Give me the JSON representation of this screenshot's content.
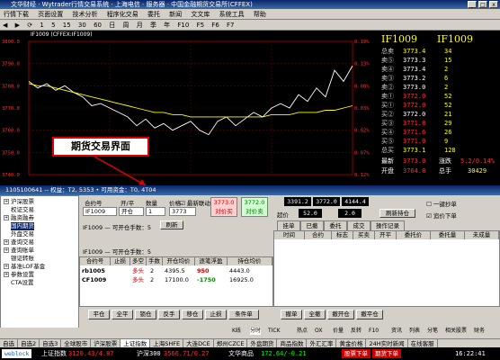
{
  "window": {
    "title": "文华财经 · Wytrader行情交易系统 · 上海电信 · 服务器 · 中国金融期货交易所(CFFEX)",
    "min": "_",
    "max": "□",
    "close": "x"
  },
  "menu": [
    "行情下载",
    "页面设置",
    "技术分析",
    "程序化交易",
    "委托",
    "新闻",
    "文文库",
    "系统工具",
    "帮助"
  ],
  "toolbar": [
    "◀",
    "▶",
    "⟳",
    "1",
    "5",
    "15",
    "30",
    "60",
    "日",
    "周",
    "月",
    "季",
    "年",
    "F10",
    "F5",
    "F6",
    "F7"
  ],
  "chart": {
    "title": "IF1009 (CFFEX:IF1009)",
    "left_ticks": [
      "3800.0",
      "3790.0",
      "3780.0",
      "3770.0",
      "3760.0",
      "3750.0",
      "3740.0"
    ],
    "right_ticks": [
      "0.19%",
      "0.13%",
      "0.08%",
      "0.03%",
      "0.02%",
      "0.07%",
      "0.12%"
    ]
  },
  "chart_data": {
    "type": "line",
    "series": [
      {
        "name": "",
        "values": [
          3782,
          3779,
          3781,
          3778,
          3780,
          3777,
          3775,
          3771,
          3772,
          3770,
          3768,
          3766,
          3762,
          3765,
          3761,
          3763,
          3760,
          3762,
          3764,
          3760,
          3758,
          3764,
          3766,
          3762,
          3765,
          3768,
          3766,
          3770,
          3772,
          3770,
          3776,
          3773,
          3779,
          3775,
          3787,
          3782,
          3789
        ]
      },
      {
        "name": "",
        "values": [
          3781,
          3780,
          3780,
          3779,
          3778,
          3777,
          3776,
          3775,
          3774,
          3773,
          3772,
          3771,
          3770,
          3769,
          3768,
          3768,
          3767,
          3767,
          3766,
          3766,
          3766,
          3766,
          3766,
          3766,
          3766,
          3766,
          3766,
          3767,
          3767,
          3767,
          3768,
          3768,
          3768,
          3769,
          3769,
          3770,
          3771
        ]
      }
    ],
    "ylim": [
      3740,
      3800
    ]
  },
  "quote": {
    "code": "IF1009",
    "rows": [
      {
        "l": "总卖",
        "p": "3773.4",
        "v": "34"
      },
      {
        "l": "卖⑤",
        "p": "3773.3",
        "v": "15"
      },
      {
        "l": "卖④",
        "p": "3773.4",
        "v": "2"
      },
      {
        "l": "卖③",
        "p": "3773.2",
        "v": "6"
      },
      {
        "l": "卖②",
        "p": "3773.0",
        "v": "2"
      },
      {
        "l": "卖①",
        "p": "3772.0",
        "v": "52"
      },
      {
        "l": "买①",
        "p": "3772.0",
        "v": "52"
      },
      {
        "l": "买②",
        "p": "3772.0",
        "v": "21"
      },
      {
        "l": "买③",
        "p": "3771.8",
        "v": "29"
      },
      {
        "l": "买④",
        "p": "3771.6",
        "v": "26"
      },
      {
        "l": "买⑤",
        "p": "3771.0",
        "v": "9"
      },
      {
        "l": "总买",
        "p": "3773.1",
        "v": "128"
      }
    ],
    "last_label": "最新",
    "last": "3773.0",
    "chg_label": "涨跌",
    "chg": "5.2/0.14%",
    "open_label": "开盘",
    "open": "3764.8",
    "vol_label": "总手",
    "vol": "30429"
  },
  "callout": "期货交易界面",
  "panel": {
    "title": "1105100641 -- 权益：T2, 5353 • 可用资金：T0, 4T04"
  },
  "tree": [
    "沪深股票",
    "权证交易",
    "融资融券",
    "国内期货",
    "外盘交易",
    "查询交易",
    "查询账单",
    "银证转账",
    "基准LOF基金",
    "参数设置",
    "CTA设置"
  ],
  "order": {
    "contract_label": "合约号",
    "contract": "IF1009",
    "oc_label": "开/平",
    "oc": "开仓",
    "qty_label": "数量",
    "qty": "1",
    "price_label": "价格",
    "price": "3773",
    "auto_label": "最新联动",
    "buy_price": "3773.0",
    "buy_label": "对价买",
    "sell_price": "3772.0",
    "sell_label": "对价卖",
    "avail_label": "IF1009 — 可开仓手数：5",
    "refresh": "刷新"
  },
  "rq": {
    "b1": "3391.2",
    "b2": "3772.0",
    "b3": "4144.4",
    "super_label": "超价",
    "s1": "52.0",
    "s2": "2.0",
    "one_key": "一键抄单",
    "follow": "追价下单",
    "close_label": "刷新持仓"
  },
  "positions": {
    "headers": [
      "合约号",
      "止损",
      "多空",
      "手数",
      "开仓均价",
      "逐笔浮盈",
      "持仓均价"
    ],
    "rows": [
      {
        "c": "rb1005",
        "s": "",
        "d": "多头",
        "q": "2",
        "o": "4395.5",
        "f": "950",
        "a": "4443.0"
      },
      {
        "c": "CF1009",
        "s": "",
        "d": "多头",
        "q": "2",
        "o": "17100.0",
        "f": "-1750",
        "a": "16925.0"
      }
    ],
    "buttons": [
      "平仓",
      "全平",
      "锁仓",
      "反手",
      "移仓",
      "止损",
      "条件单"
    ]
  },
  "orders": {
    "tabs": [
      "挂单",
      "已撤",
      "委托",
      "成交",
      "操作记录"
    ],
    "headers": [
      "时间",
      "合约",
      "标志",
      "买卖",
      "开平",
      "委托价",
      "委托量",
      "未成量"
    ],
    "buttons": [
      "撤单",
      "全撤",
      "撤开仓",
      "撤平仓"
    ]
  },
  "bottom_tabs": [
    "K线",
    "分时",
    "TICK",
    "热点",
    "OX",
    "价量",
    "反转",
    "F10",
    "资讯",
    "列表",
    "分笔",
    "相关股票",
    "财务"
  ],
  "stock_tabs": [
    "自选",
    "自选2",
    "自选3",
    "全球股市",
    "沪深股票",
    "上证指数",
    "上海SHFE",
    "大连DCE",
    "郑州CZCE",
    "外盘期货",
    "商品指数",
    "外汇汇率",
    "黄金价格",
    "24H实时新闻",
    "在线客服"
  ],
  "status": {
    "brand": "weblock",
    "idx1": "上证指数",
    "v1": "3120.43/4.87",
    "idx2": "沪深300",
    "v2": "3566.71/0.27",
    "idx3": "文华商品",
    "v3": "172.64/-0.21",
    "order_btn": "股票下单",
    "order_btn2": "期货下单",
    "time": "16:22:41"
  }
}
